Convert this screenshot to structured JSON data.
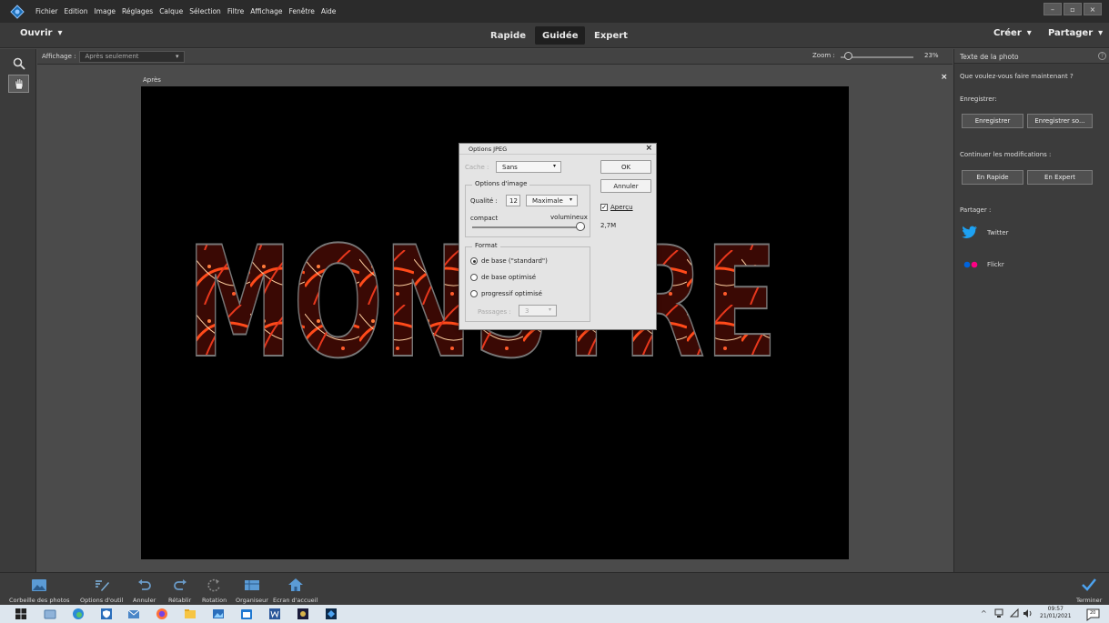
{
  "menu": [
    "Fichier",
    "Edition",
    "Image",
    "Réglages",
    "Calque",
    "Sélection",
    "Filtre",
    "Affichage",
    "Fenêtre",
    "Aide"
  ],
  "window_controls": [
    "–",
    "▫",
    "×"
  ],
  "modebar": {
    "open_label": "Ouvrir",
    "tabs": [
      "Rapide",
      "Guidée",
      "Expert"
    ],
    "active_tab": "Guidée",
    "create_label": "Créer",
    "share_label": "Partager",
    "dropdown_glyph": "▾"
  },
  "options_bar": {
    "view_label": "Affichage :",
    "view_value": "Après seulement",
    "zoom_label": "Zoom :",
    "zoom_value": "23%",
    "zoom_fraction": 0.05
  },
  "canvas": {
    "after_label": "Après",
    "close_glyph": "×",
    "image_text": "MONSTRE",
    "colors": {
      "background": "#000000",
      "accent": "#e8371c"
    }
  },
  "dialog": {
    "title": "Options JPEG",
    "cache_label": "Cache :",
    "cache_value": "Sans",
    "ok_label": "OK",
    "cancel_label": "Annuler",
    "image_options_title": "Options d'image",
    "quality_label": "Qualité :",
    "quality_value": "12",
    "quality_preset": "Maximale",
    "compact_label": "compact",
    "large_label": "volumineux",
    "quality_fraction": 1.0,
    "preview_label": "Aperçu",
    "preview_checked": true,
    "size_value": "2,7M",
    "format_title": "Format",
    "formats": [
      "de base (\"standard\")",
      "de base optimisé",
      "progressif optimisé"
    ],
    "selected_format": 0,
    "passes_label": "Passages :",
    "passes_value": "3"
  },
  "right_panel": {
    "title": "Texte de la photo",
    "help_glyph": "?",
    "question": "Que voulez-vous faire maintenant ?",
    "save_heading": "Enregistrer:",
    "save_button": "Enregistrer",
    "save_as_button": "Enregistrer so...",
    "continue_heading": "Continuer les modifications :",
    "quick_button": "En Rapide",
    "expert_button": "En Expert",
    "share_heading": "Partager :",
    "share_items": [
      "Twitter",
      "Flickr"
    ]
  },
  "bottom_bar": {
    "items": [
      "Corbeille des photos",
      "Options d'outil",
      "Annuler",
      "Rétablir",
      "Rotation",
      "Organiseur",
      "Ecran d'accueil"
    ],
    "finish_label": "Terminer"
  },
  "taskbar": {
    "time": "09:57",
    "date": "21/01/2021",
    "notification_count": "20"
  }
}
